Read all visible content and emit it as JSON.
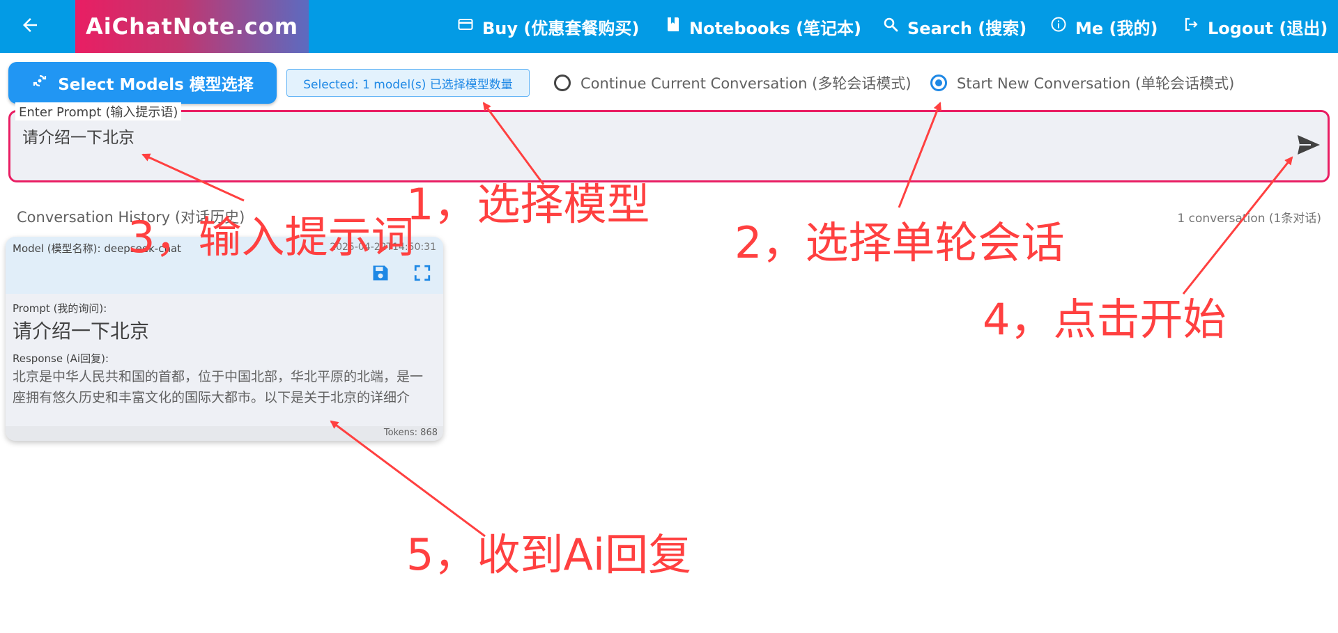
{
  "header": {
    "brand": "AiChatNote.com",
    "nav": {
      "buy": "Buy (优惠套餐购买)",
      "notebooks": "Notebooks (笔记本)",
      "search": "Search (搜索)",
      "me": "Me (我的)",
      "logout": "Logout (退出)"
    }
  },
  "controls": {
    "select_models_label": "Select Models 模型选择",
    "selected_chip": "Selected: 1 model(s) 已选择模型数量",
    "mode": {
      "continue_label": "Continue Current Conversation (多轮会话模式)",
      "new_label": "Start New Conversation (单轮会话模式)",
      "selected": "new"
    }
  },
  "prompt": {
    "label": "Enter Prompt (输入提示语)",
    "value": "请介绍一下北京"
  },
  "history": {
    "title": "Conversation History (对话历史)",
    "count": "1 conversation (1条对话)",
    "cards": [
      {
        "model": "Model (模型名称): deepseek-chat",
        "timestamp": "2025-04-22T14:50:31",
        "prompt_label": "Prompt (我的询问):",
        "prompt": "请介绍一下北京",
        "response_label": "Response (Ai回复):",
        "response": "北京是中华人民共和国的首都，位于中国北部，华北平原的北端，是一座拥有悠久历史和丰富文化的国际大都市。以下是关于北京的详细介绍：",
        "tokens": "Tokens: 868"
      }
    ]
  },
  "annotations": {
    "step1": "1，选择模型",
    "step2": "2，选择单轮会话",
    "step3": "3，输入提示词",
    "step4": "4，点击开始",
    "step5": "5，收到Ai回复"
  },
  "colors": {
    "appbar": "#039be5",
    "accent_blue": "#2196f3",
    "prompt_border": "#e91e63",
    "annotation_red": "#ff4040"
  },
  "icons": {
    "back": "arrow-left-icon",
    "buy": "credit-card-icon",
    "notebooks": "book-icon",
    "search": "search-icon",
    "me": "info-icon",
    "logout": "logout-icon",
    "select_models": "model-swap-icon",
    "send": "send-icon",
    "save": "floppy-disk-icon",
    "fullscreen": "fullscreen-icon"
  }
}
